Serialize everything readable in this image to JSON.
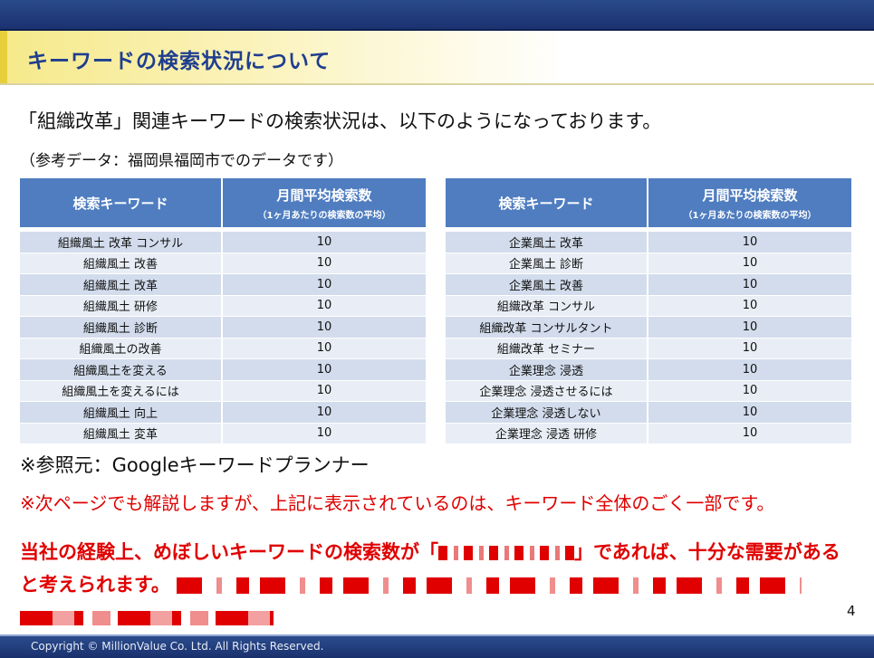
{
  "slide": {
    "title": "キーワードの検索状況について",
    "intro": "「組織改革」関連キーワードの検索状況は、以下のようになっております。",
    "note": "（参考データ：福岡県福岡市でのデータです）",
    "source": "※参照元：Googleキーワードプランナー",
    "red_note": "※次ページでも解説しますが、上記に表示されているのは、キーワード全体のごく一部です。",
    "red_bold_part1": "当社の経験上、めぼしいキーワードの検索数が「",
    "red_bold_part2": "」であれば、十分な需要があると考えられます。",
    "page_number": "4",
    "footer": "Copyright © MillionValue Co. Ltd. All Rights Reserved."
  },
  "table_headers": {
    "keyword": "検索キーワード",
    "monthly": "月間平均検索数",
    "monthly_sub": "（1ヶ月あたりの検索数の平均）"
  },
  "left_table": [
    {
      "keyword": "組織風土 改革 コンサル",
      "count": "10"
    },
    {
      "keyword": "組織風土 改善",
      "count": "10"
    },
    {
      "keyword": "組織風土 改革",
      "count": "10"
    },
    {
      "keyword": "組織風土 研修",
      "count": "10"
    },
    {
      "keyword": "組織風土 診断",
      "count": "10"
    },
    {
      "keyword": "組織風土の改善",
      "count": "10"
    },
    {
      "keyword": "組織風土を変える",
      "count": "10"
    },
    {
      "keyword": "組織風土を変えるには",
      "count": "10"
    },
    {
      "keyword": "組織風土 向上",
      "count": "10"
    },
    {
      "keyword": "組織風土 変革",
      "count": "10"
    }
  ],
  "right_table": [
    {
      "keyword": "企業風土 改革",
      "count": "10"
    },
    {
      "keyword": "企業風土 診断",
      "count": "10"
    },
    {
      "keyword": "企業風土 改善",
      "count": "10"
    },
    {
      "keyword": "組織改革 コンサル",
      "count": "10"
    },
    {
      "keyword": "組織改革 コンサルタント",
      "count": "10"
    },
    {
      "keyword": "組織改革 セミナー",
      "count": "10"
    },
    {
      "keyword": "企業理念 浸透",
      "count": "10"
    },
    {
      "keyword": "企業理念 浸透させるには",
      "count": "10"
    },
    {
      "keyword": "企業理念 浸透しない",
      "count": "10"
    },
    {
      "keyword": "企業理念 浸透 研修",
      "count": "10"
    }
  ]
}
